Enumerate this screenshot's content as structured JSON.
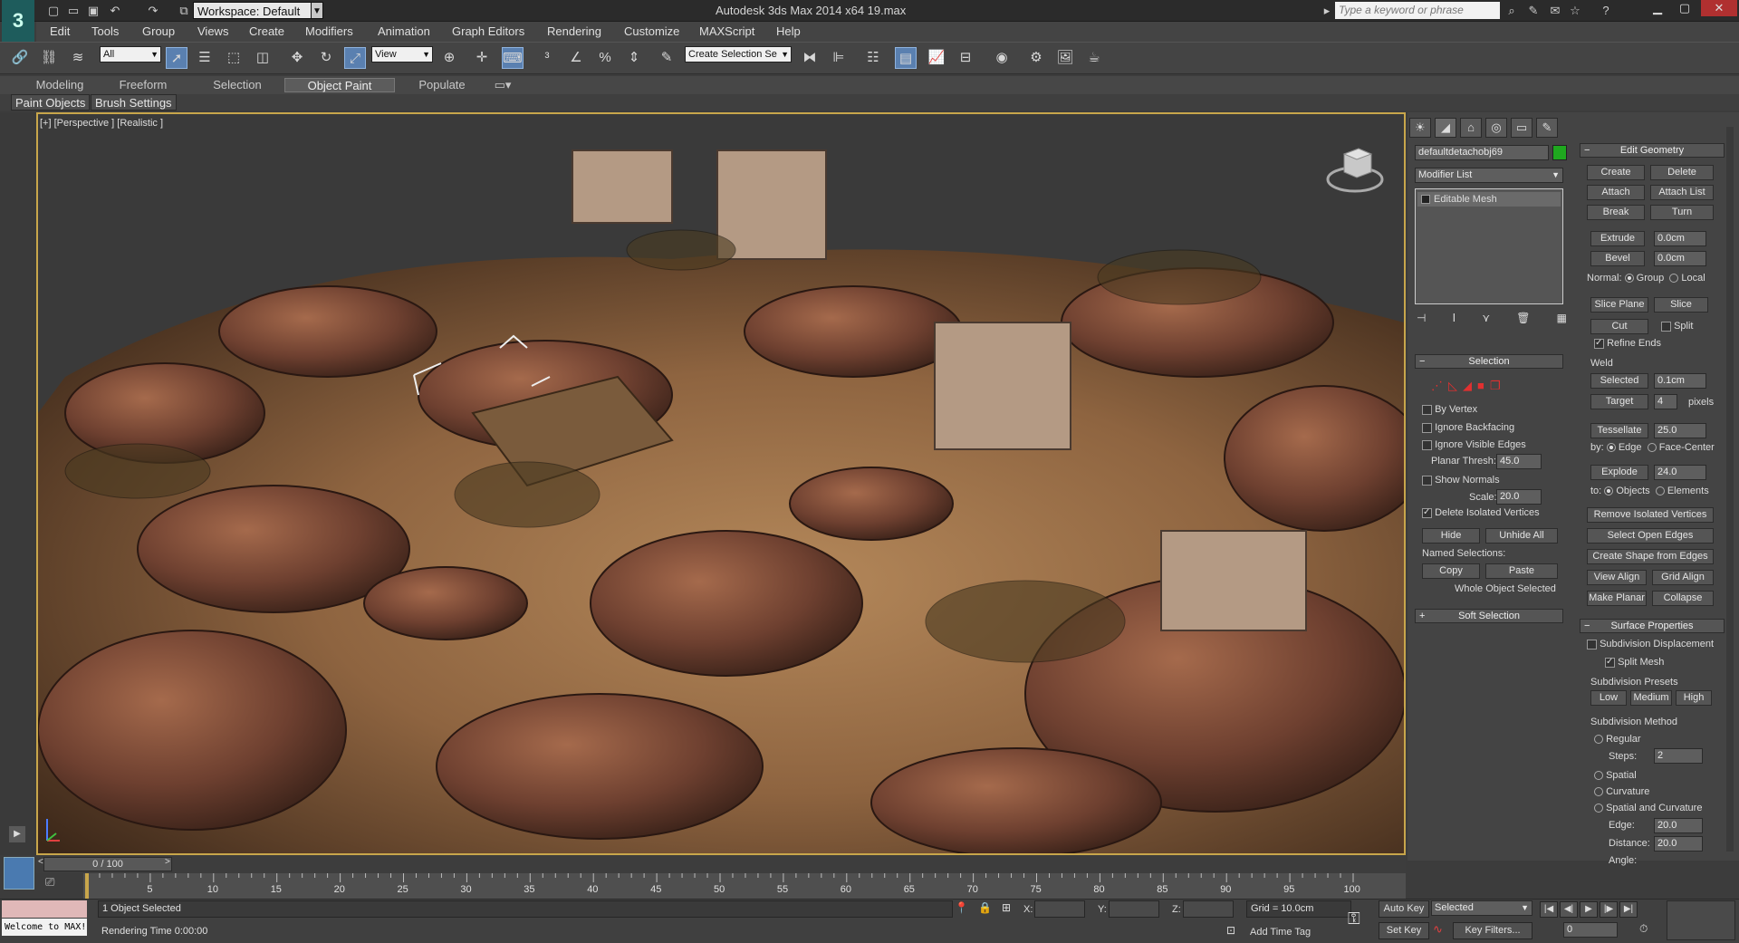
{
  "titlebar": {
    "workspace": "Workspace: Default",
    "window_title": "Autodesk 3ds Max  2014 x64       19.max",
    "search_placeholder": "Type a keyword or phrase"
  },
  "menus": [
    "Edit",
    "Tools",
    "Group",
    "Views",
    "Create",
    "Modifiers",
    "Animation",
    "Graph Editors",
    "Rendering",
    "Customize",
    "MAXScript",
    "Help"
  ],
  "toolbar": {
    "selection_filter": "All",
    "ref_coord": "View",
    "named_selection_placeholder": "Create Selection Se"
  },
  "ribbon": {
    "tabs": [
      "Modeling",
      "Freeform",
      "Selection",
      "Object Paint",
      "Populate"
    ],
    "active_tab": "Object Paint",
    "subtabs": [
      "Paint Objects",
      "Brush Settings"
    ]
  },
  "viewport": {
    "label": "[+] [Perspective ] [Realistic ]"
  },
  "command_panel": {
    "object_name": "defaultdetachobj69",
    "object_color": "#1fa81f",
    "modifier_list": "Modifier List",
    "stack_item": "Editable Mesh",
    "selection": {
      "title": "Selection",
      "by_vertex": "By Vertex",
      "ignore_backfacing": "Ignore Backfacing",
      "ignore_visible_edges": "Ignore Visible Edges",
      "planar_thresh_label": "Planar Thresh:",
      "planar_thresh": "45.0",
      "show_normals": "Show Normals",
      "scale_label": "Scale:",
      "scale": "20.0",
      "delete_isolated": "Delete Isolated Vertices",
      "hide": "Hide",
      "unhide_all": "Unhide All",
      "named_selections": "Named Selections:",
      "copy": "Copy",
      "paste": "Paste",
      "status": "Whole Object Selected"
    },
    "soft_selection": "Soft Selection",
    "edit_geometry": {
      "title": "Edit Geometry",
      "create": "Create",
      "delete": "Delete",
      "attach": "Attach",
      "attach_list": "Attach List",
      "break": "Break",
      "turn": "Turn",
      "extrude": "Extrude",
      "extrude_val": "0.0cm",
      "bevel": "Bevel",
      "bevel_val": "0.0cm",
      "normal_label": "Normal:",
      "group": "Group",
      "local": "Local",
      "slice_plane": "Slice Plane",
      "slice": "Slice",
      "cut": "Cut",
      "split": "Split",
      "refine_ends": "Refine Ends",
      "weld": "Weld",
      "selected": "Selected",
      "selected_val": "0.1cm",
      "target": "Target",
      "target_val": "4",
      "pixels": "pixels",
      "tessellate": "Tessellate",
      "tessellate_val": "25.0",
      "by_label": "by:",
      "edge": "Edge",
      "face_center": "Face-Center",
      "explode": "Explode",
      "explode_val": "24.0",
      "to_label": "to:",
      "objects": "Objects",
      "elements": "Elements",
      "remove_isolated": "Remove Isolated Vertices",
      "select_open_edges": "Select Open Edges",
      "create_shape": "Create Shape from Edges",
      "view_align": "View Align",
      "grid_align": "Grid Align",
      "make_planar": "Make Planar",
      "collapse": "Collapse"
    },
    "surface": {
      "title": "Surface Properties",
      "subdivision_displacement": "Subdivision Displacement",
      "split_mesh": "Split Mesh",
      "presets_label": "Subdivision Presets",
      "low": "Low",
      "medium": "Medium",
      "high": "High",
      "method_label": "Subdivision Method",
      "regular": "Regular",
      "steps_label": "Steps:",
      "steps": "2",
      "spatial": "Spatial",
      "curvature": "Curvature",
      "spatial_curvature": "Spatial and Curvature",
      "edge_label": "Edge:",
      "edge_val": "20.0",
      "distance_label": "Distance:",
      "distance_val": "20.0",
      "angle_label": "Angle:"
    }
  },
  "timeline": {
    "frame": "0 / 100",
    "ticks": [
      "5",
      "10",
      "15",
      "20",
      "25",
      "30",
      "35",
      "40",
      "45",
      "50",
      "55",
      "60",
      "65",
      "70",
      "75",
      "80",
      "85",
      "90",
      "95",
      "100"
    ]
  },
  "status": {
    "maxscript": "Welcome to MAX!",
    "selected": "1 Object Selected",
    "render_time": "Rendering Time  0:00:00",
    "x_label": "X:",
    "y_label": "Y:",
    "z_label": "Z:",
    "grid": "Grid = 10.0cm",
    "add_time_tag": "Add Time Tag",
    "auto_key": "Auto Key",
    "set_key": "Set Key",
    "key_mode": "Selected",
    "key_filters": "Key Filters...",
    "current_frame": "0"
  }
}
